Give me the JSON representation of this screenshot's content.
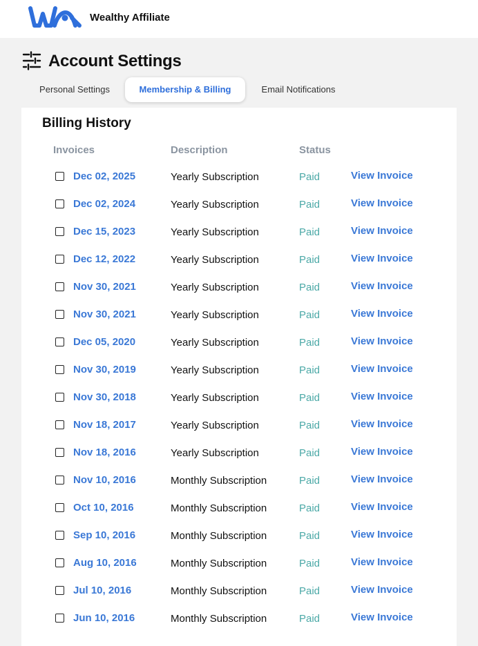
{
  "brand": {
    "name": "Wealthy Affiliate",
    "logo_icon": "wa-logo-icon",
    "accent": "#2f6fdb"
  },
  "page": {
    "title": "Account Settings",
    "icon": "settings-sliders-icon"
  },
  "tabs": [
    {
      "label": "Personal Settings",
      "active": false
    },
    {
      "label": "Membership & Billing",
      "active": true
    },
    {
      "label": "Email Notifications",
      "active": false
    }
  ],
  "billing": {
    "title": "Billing History",
    "columns": {
      "invoices": "Invoices",
      "description": "Description",
      "status": "Status"
    },
    "view_label": "View Invoice",
    "rows": [
      {
        "date": "Dec 02, 2025",
        "description": "Yearly Subscription",
        "status": "Paid"
      },
      {
        "date": "Dec 02, 2024",
        "description": "Yearly Subscription",
        "status": "Paid"
      },
      {
        "date": "Dec 15, 2023",
        "description": "Yearly Subscription",
        "status": "Paid"
      },
      {
        "date": "Dec 12, 2022",
        "description": "Yearly Subscription",
        "status": "Paid"
      },
      {
        "date": "Nov 30, 2021",
        "description": "Yearly Subscription",
        "status": "Paid"
      },
      {
        "date": "Nov 30, 2021",
        "description": "Yearly Subscription",
        "status": "Paid"
      },
      {
        "date": "Dec 05, 2020",
        "description": "Yearly Subscription",
        "status": "Paid"
      },
      {
        "date": "Nov 30, 2019",
        "description": "Yearly Subscription",
        "status": "Paid"
      },
      {
        "date": "Nov 30, 2018",
        "description": "Yearly Subscription",
        "status": "Paid"
      },
      {
        "date": "Nov 18, 2017",
        "description": "Yearly Subscription",
        "status": "Paid"
      },
      {
        "date": "Nov 18, 2016",
        "description": "Yearly Subscription",
        "status": "Paid"
      },
      {
        "date": "Nov 10, 2016",
        "description": "Monthly Subscription",
        "status": "Paid"
      },
      {
        "date": "Oct 10, 2016",
        "description": "Monthly Subscription",
        "status": "Paid"
      },
      {
        "date": "Sep 10, 2016",
        "description": "Monthly Subscription",
        "status": "Paid"
      },
      {
        "date": "Aug 10, 2016",
        "description": "Monthly Subscription",
        "status": "Paid"
      },
      {
        "date": "Jul 10, 2016",
        "description": "Monthly Subscription",
        "status": "Paid"
      },
      {
        "date": "Jun 10, 2016",
        "description": "Monthly Subscription",
        "status": "Paid"
      }
    ]
  }
}
